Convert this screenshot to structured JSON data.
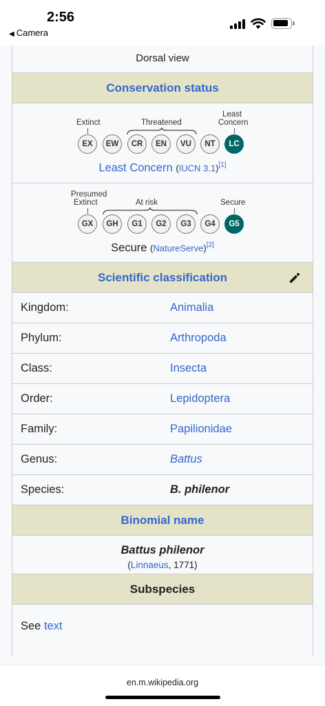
{
  "status_bar": {
    "time": "2:56",
    "back_label": "Camera"
  },
  "infobox": {
    "image_caption": "Dorsal view",
    "conservation_header": "Conservation status",
    "iucn": {
      "labels": {
        "extinct": "Extinct",
        "threatened": "Threatened",
        "least_concern_line1": "Least",
        "least_concern_line2": "Concern"
      },
      "codes": [
        "EX",
        "EW",
        "CR",
        "EN",
        "VU",
        "NT",
        "LC"
      ],
      "active": "LC",
      "status_text": "Least Concern",
      "source_link": "IUCN 3.1",
      "ref": "[1]"
    },
    "natureserve": {
      "labels": {
        "presumed_line1": "Presumed",
        "presumed_line2": "Extinct",
        "at_risk": "At risk",
        "secure": "Secure"
      },
      "codes": [
        "GX",
        "GH",
        "G1",
        "G2",
        "G3",
        "G4",
        "G5"
      ],
      "active": "G5",
      "status_text": "Secure",
      "open_paren": "(",
      "source_link": "NatureServe",
      "close_paren": ")",
      "ref": "[2]"
    },
    "classification_header": "Scientific classification",
    "taxonomy": [
      {
        "rank": "Kingdom:",
        "value": "Animalia"
      },
      {
        "rank": "Phylum:",
        "value": "Arthropoda"
      },
      {
        "rank": "Class:",
        "value": "Insecta"
      },
      {
        "rank": "Order:",
        "value": "Lepidoptera"
      },
      {
        "rank": "Family:",
        "value": "Papilionidae"
      },
      {
        "rank": "Genus:",
        "value": "Battus"
      },
      {
        "rank": "Species:",
        "value": "B. philenor"
      }
    ],
    "binomial_header": "Binomial name",
    "binomial": {
      "name": "Battus philenor",
      "open_paren": "(",
      "author_link": "Linnaeus",
      "year": ", 1771)"
    },
    "subspecies_header": "Subspecies",
    "subspecies": {
      "see": "See ",
      "link": "text"
    }
  },
  "footer": {
    "url": "en.m.wikipedia.org"
  },
  "colors": {
    "link": "#3366cc",
    "header_bg": "#e4e3c7",
    "active_circle": "#006666",
    "border": "#c8ccd1"
  }
}
